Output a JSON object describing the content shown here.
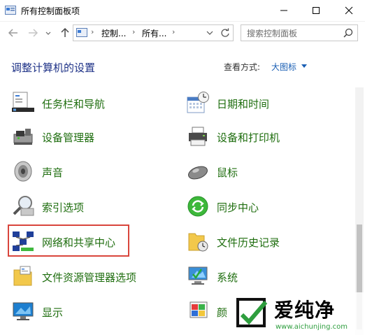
{
  "window": {
    "title": "所有控制面板项"
  },
  "address": {
    "segments": [
      "控制...",
      "所有..."
    ],
    "search_placeholder": "搜索控制面板"
  },
  "header": {
    "title": "调整计算机的设置",
    "view_by_label": "查看方式:",
    "view_by_value": "大图标"
  },
  "items": [
    {
      "label": "任务栏和导航",
      "icon": "taskbar-icon"
    },
    {
      "label": "日期和时间",
      "icon": "calendar-clock-icon"
    },
    {
      "label": "设备管理器",
      "icon": "device-manager-icon"
    },
    {
      "label": "设备和打印机",
      "icon": "printer-icon"
    },
    {
      "label": "声音",
      "icon": "speaker-icon"
    },
    {
      "label": "鼠标",
      "icon": "mouse-icon"
    },
    {
      "label": "索引选项",
      "icon": "index-search-icon"
    },
    {
      "label": "同步中心",
      "icon": "sync-icon"
    },
    {
      "label": "网络和共享中心",
      "icon": "network-icon",
      "highlighted": true
    },
    {
      "label": "文件历史记录",
      "icon": "file-history-icon"
    },
    {
      "label": "文件资源管理器选项",
      "icon": "folder-options-icon"
    },
    {
      "label": "系统",
      "icon": "system-icon"
    },
    {
      "label": "显示",
      "icon": "display-icon"
    },
    {
      "label": "颜",
      "icon": "color-icon"
    }
  ],
  "watermark": {
    "brand": "爱纯净",
    "url": "www.aichunjing.com"
  },
  "colors": {
    "item_text": "#1f6e0f",
    "title": "#1e3287",
    "link": "#1a5fb4",
    "highlight": "#d9453c"
  }
}
